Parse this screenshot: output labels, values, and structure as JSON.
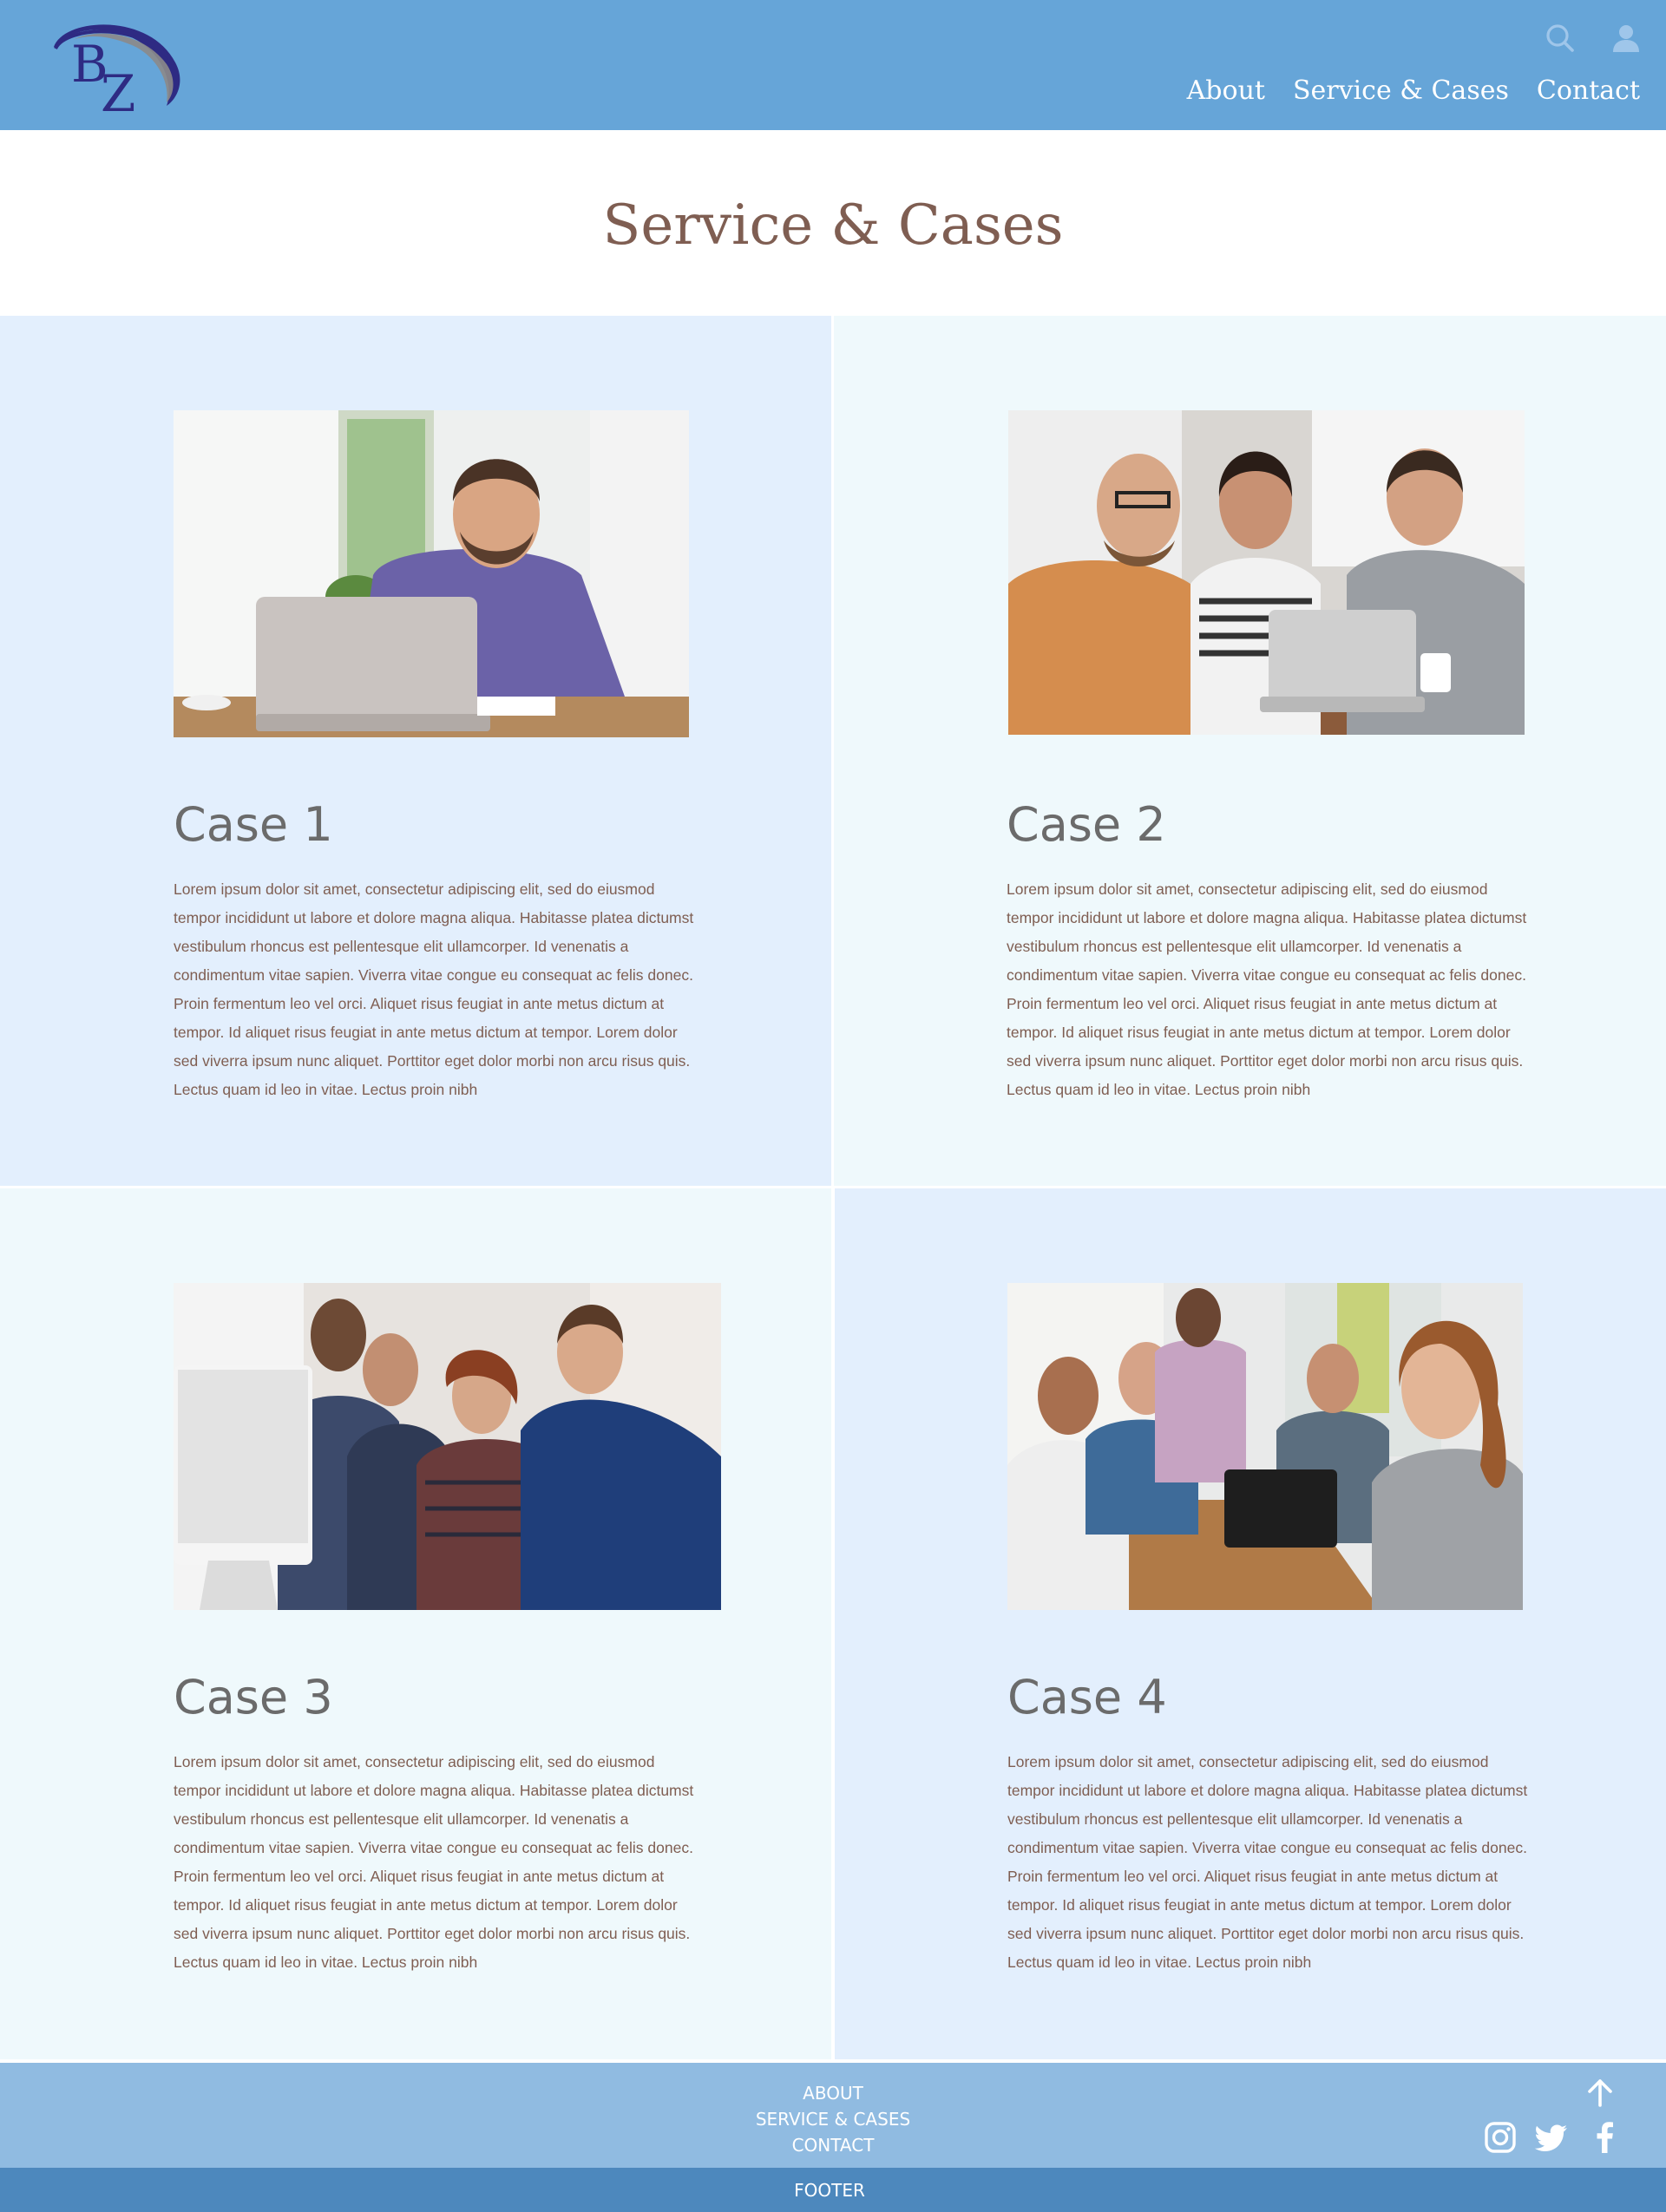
{
  "brand": {
    "logo_text": "BZ",
    "colors": {
      "header_bg": "#66a5d8",
      "footer_bg": "#90bbe1",
      "footer_bar_bg": "#4d88bd",
      "title_color": "#7f5e52",
      "logo_navy": "#2e2b83"
    }
  },
  "header": {
    "icons": [
      "search-icon",
      "user-icon"
    ],
    "nav": [
      {
        "label": "About"
      },
      {
        "label": "Service & Cases"
      },
      {
        "label": "Contact"
      }
    ]
  },
  "page": {
    "title": "Service & Cases"
  },
  "cases": [
    {
      "heading": "Case 1",
      "body": "Lorem ipsum dolor sit amet, consectetur adipiscing elit, sed do eiusmod tempor incididunt ut labore et dolore magna aliqua. Habitasse platea dictumst vestibulum rhoncus est pellentesque elit ullamcorper. Id venenatis a condimentum vitae sapien. Viverra vitae congue eu consequat ac felis donec. Proin fermentum leo vel orci. Aliquet risus feugiat in ante metus dictum at tempor. Id aliquet risus feugiat in ante metus dictum at tempor. Lorem dolor sed viverra ipsum nunc aliquet. Porttitor eget dolor morbi non arcu risus quis. Lectus quam id leo in vitae. Lectus proin nibh"
    },
    {
      "heading": "Case 2",
      "body": "Lorem ipsum dolor sit amet, consectetur adipiscing elit, sed do eiusmod tempor incididunt ut labore et dolore magna aliqua. Habitasse platea dictumst vestibulum rhoncus est pellentesque elit ullamcorper. Id venenatis a condimentum vitae sapien. Viverra vitae congue eu consequat ac felis donec. Proin fermentum leo vel orci. Aliquet risus feugiat in ante metus dictum at tempor. Id aliquet risus feugiat in ante metus dictum at tempor. Lorem dolor sed viverra ipsum nunc aliquet. Porttitor eget dolor morbi non arcu risus quis. Lectus quam id leo in vitae. Lectus proin nibh"
    },
    {
      "heading": "Case 3",
      "body": "Lorem ipsum dolor sit amet, consectetur adipiscing elit, sed do eiusmod tempor incididunt ut labore et dolore magna aliqua. Habitasse platea dictumst vestibulum rhoncus est pellentesque elit ullamcorper. Id venenatis a condimentum vitae sapien. Viverra vitae congue eu consequat ac felis donec. Proin fermentum leo vel orci. Aliquet risus feugiat in ante metus dictum at tempor. Id aliquet risus feugiat in ante metus dictum at tempor. Lorem dolor sed viverra ipsum nunc aliquet. Porttitor eget dolor morbi non arcu risus quis. Lectus quam id leo in vitae. Lectus proin nibh"
    },
    {
      "heading": "Case 4",
      "body": "Lorem ipsum dolor sit amet, consectetur adipiscing elit, sed do eiusmod tempor incididunt ut labore et dolore magna aliqua. Habitasse platea dictumst vestibulum rhoncus est pellentesque elit ullamcorper. Id venenatis a condimentum vitae sapien. Viverra vitae congue eu consequat ac felis donec. Proin fermentum leo vel orci. Aliquet risus feugiat in ante metus dictum at tempor. Id aliquet risus feugiat in ante metus dictum at tempor. Lorem dolor sed viverra ipsum nunc aliquet. Porttitor eget dolor morbi non arcu risus quis. Lectus quam id leo in vitae. Lectus proin nibh"
    }
  ],
  "footer": {
    "links": [
      {
        "label": "ABOUT"
      },
      {
        "label": "SERVICE & CASES"
      },
      {
        "label": "CONTACT"
      }
    ],
    "icons": [
      "back-to-top-icon",
      "instagram-icon",
      "twitter-icon",
      "facebook-icon"
    ],
    "bar_label": "FOOTER"
  }
}
